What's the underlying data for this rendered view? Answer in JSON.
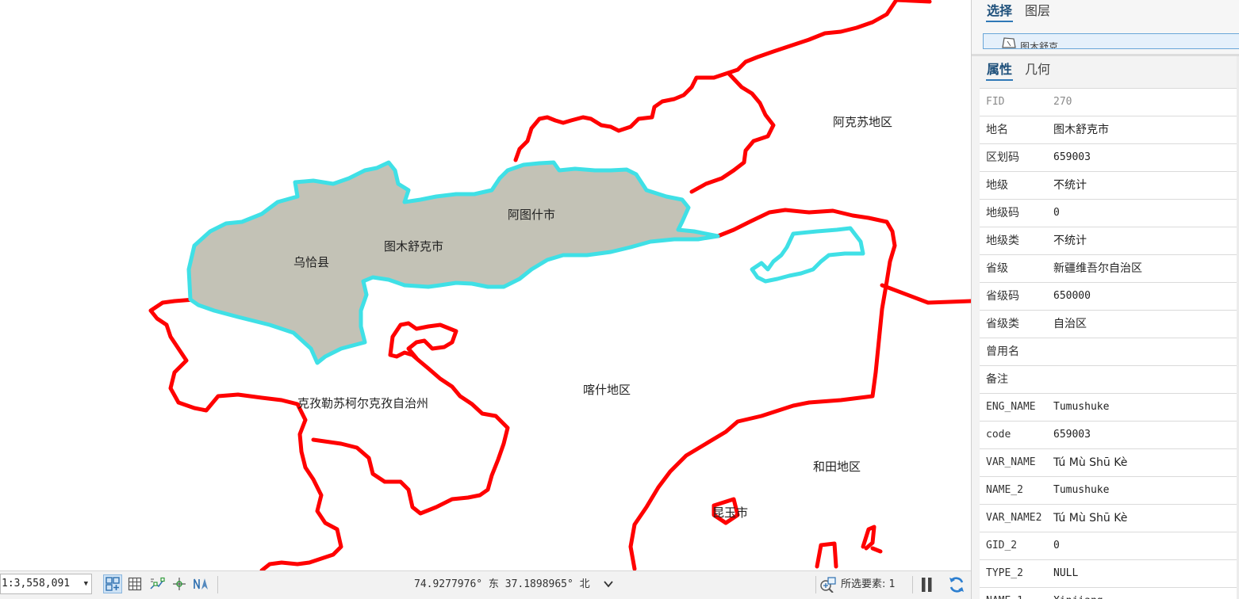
{
  "map": {
    "labels": {
      "aksu": "阿克苏地区",
      "tumshuq": "图木舒克市",
      "atushi": "阿图什市",
      "wuqia": "乌恰县",
      "kizilsu": "克孜勒苏柯尔克孜自治州",
      "kashgar": "喀什地区",
      "hotan": "和田地区",
      "kunyu": "昆玉市"
    },
    "boundary_color": "#ff0000",
    "selection_color": "#3fe0e6",
    "selection_fill": "#c3c2b6"
  },
  "statusbar": {
    "scale": "1:3,558,091",
    "coords": "74.9277976° 东  37.1898965° 北",
    "selected_label": "所选要素:",
    "selected_count": "1"
  },
  "panel": {
    "upper_tabs": [
      "选择",
      "图层"
    ],
    "upper_active": "选择",
    "selected_item": "图木舒克",
    "lower_tabs": [
      "属性",
      "几何"
    ],
    "lower_active": "属性",
    "attributes": [
      {
        "key": "FID",
        "value": "270",
        "readonly": true
      },
      {
        "key": "地名",
        "value": "图木舒克市"
      },
      {
        "key": "区划码",
        "value": "659003"
      },
      {
        "key": "地级",
        "value": "不统计"
      },
      {
        "key": "地级码",
        "value": "0"
      },
      {
        "key": "地级类",
        "value": "不统计"
      },
      {
        "key": "省级",
        "value": "新疆维吾尔自治区"
      },
      {
        "key": "省级码",
        "value": "650000"
      },
      {
        "key": "省级类",
        "value": "自治区"
      },
      {
        "key": "曾用名",
        "value": ""
      },
      {
        "key": "备注",
        "value": ""
      },
      {
        "key": "ENG_NAME",
        "value": "Tumushuke"
      },
      {
        "key": "code",
        "value": "659003"
      },
      {
        "key": "VAR_NAME",
        "value": "Tú Mù Shū Kè"
      },
      {
        "key": "NAME_2",
        "value": "Tumushuke"
      },
      {
        "key": "VAR_NAME2",
        "value": "Tú Mù Shū Kè"
      },
      {
        "key": "GID_2",
        "value": "0"
      },
      {
        "key": "TYPE_2",
        "value": "NULL"
      },
      {
        "key": "NAME_1",
        "value": "Xinjiang"
      }
    ]
  }
}
